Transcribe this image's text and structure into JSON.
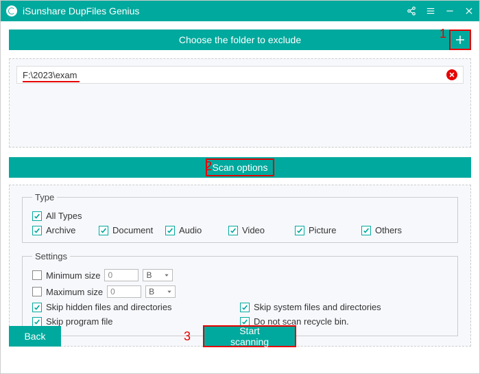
{
  "titlebar": {
    "title": "iSunshare DupFiles Genius"
  },
  "header": {
    "text": "Choose the folder to exclude"
  },
  "markers": {
    "m1": "1",
    "m2": "2",
    "m3": "3"
  },
  "folder": {
    "path": "F:\\2023\\exam"
  },
  "optionsbar": {
    "label": "Scan options"
  },
  "type": {
    "legend": "Type",
    "all": "All Types",
    "items": [
      "Archive",
      "Document",
      "Audio",
      "Video",
      "Picture",
      "Others"
    ]
  },
  "settings": {
    "legend": "Settings",
    "min_label": "Minimum size",
    "min_value": "0",
    "min_unit": "B",
    "max_label": "Maximum size",
    "max_value": "0",
    "max_unit": "B",
    "skip_hidden": "Skip hidden files and directories",
    "skip_program": "Skip program file",
    "skip_system": "Skip system files and directories",
    "skip_recycle": "Do not scan recycle bin."
  },
  "buttons": {
    "back": "Back",
    "start": "Start scanning"
  }
}
